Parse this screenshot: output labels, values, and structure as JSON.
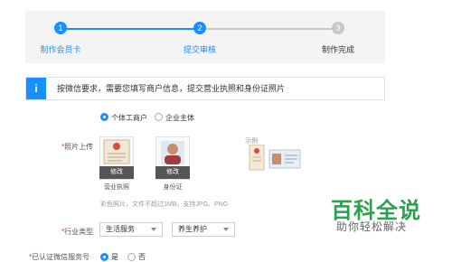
{
  "steps": [
    {
      "num": "1",
      "label": "制作会员卡",
      "state": "done"
    },
    {
      "num": "2",
      "label": "提交审核",
      "state": "active"
    },
    {
      "num": "3",
      "label": "制作完成",
      "state": "pending"
    }
  ],
  "notice": {
    "icon": "i",
    "text": "按微信要求，需要您填写商户信息，提交营业执照和身份证照片"
  },
  "entity_type": {
    "options": [
      "个体工商户",
      "企业主体"
    ],
    "selected": "个体工商户"
  },
  "photo_upload": {
    "label": "照片上传",
    "required_mark": "*",
    "cards": [
      {
        "edit": "修改",
        "caption": "营业执照"
      },
      {
        "edit": "修改",
        "caption": "身份证"
      }
    ],
    "example_label": "示例",
    "hint": "彩色照片，文件不超过1MB，支持JPG、PNG"
  },
  "industry": {
    "label": "行业类型",
    "required_mark": "*",
    "primary": "生活服务",
    "secondary": "养生养护"
  },
  "wechat_service": {
    "label": "已认证微信服务号",
    "required_mark": "*",
    "options": [
      "是",
      "否"
    ],
    "selected": "是"
  },
  "watermark": {
    "title": "百科全说",
    "subtitle": "助你轻松解决"
  },
  "colors": {
    "accent": "#1890ff",
    "pending": "#c8c8c8",
    "required": "#e4393c",
    "watermark_green": "#27a34b"
  }
}
